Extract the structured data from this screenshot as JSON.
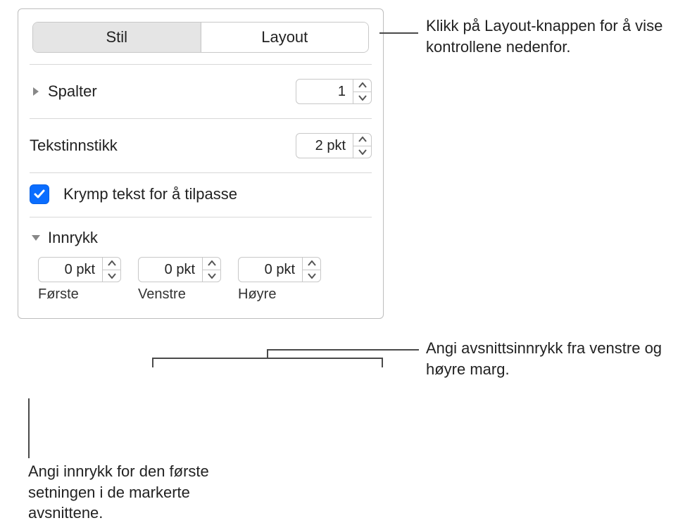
{
  "tabs": {
    "style": "Stil",
    "layout": "Layout"
  },
  "columns": {
    "label": "Spalter",
    "value": "1"
  },
  "textInset": {
    "label": "Tekstinnstikk",
    "value": "2 pkt"
  },
  "shrink": {
    "label": "Krymp tekst for å tilpasse"
  },
  "indent": {
    "heading": "Innrykk",
    "first": {
      "value": "0 pkt",
      "label": "Første"
    },
    "left": {
      "value": "0 pkt",
      "label": "Venstre"
    },
    "right": {
      "value": "0 pkt",
      "label": "Høyre"
    }
  },
  "callouts": {
    "layout": "Klikk på Layout-knappen for å vise kontrollene nedenfor.",
    "margins": "Angi avsnittsinnrykk fra venstre og høyre marg.",
    "first": "Angi innrykk for den første setningen i de markerte avsnittene."
  }
}
